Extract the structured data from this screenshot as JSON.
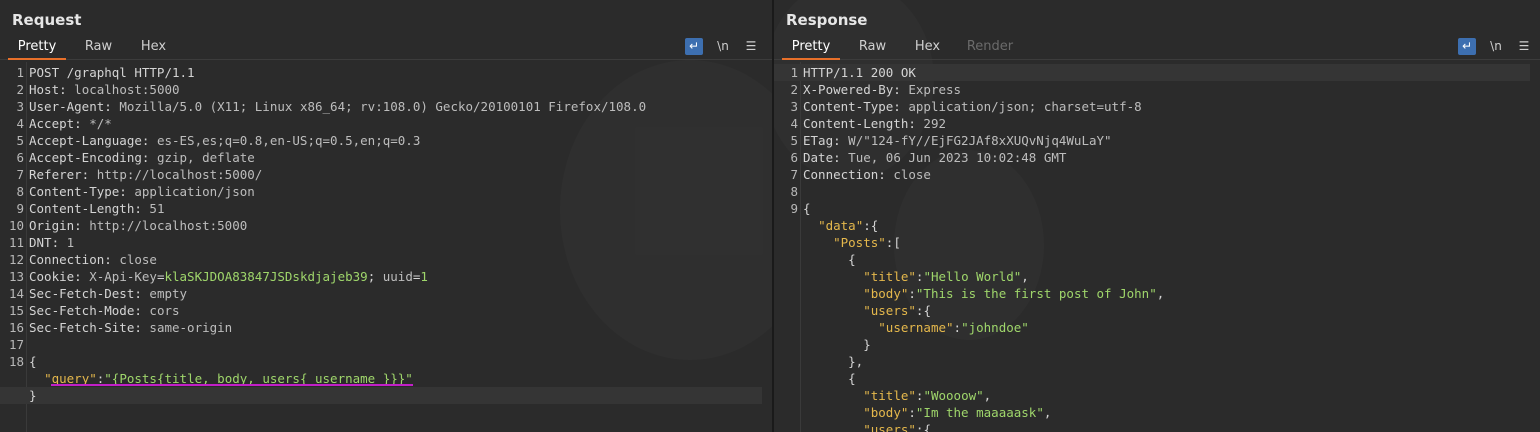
{
  "request": {
    "title": "Request",
    "tabs": [
      "Pretty",
      "Raw",
      "Hex"
    ],
    "tools": {
      "wrap_icon": "↵",
      "newline": "\\n",
      "menu": "☰"
    },
    "lines": [
      {
        "n": "1",
        "k": "POST /graphql HTTP/1.1",
        "v": ""
      },
      {
        "n": "2",
        "k": "Host:",
        "v": " localhost:5000"
      },
      {
        "n": "3",
        "k": "User-Agent:",
        "v": " Mozilla/5.0 (X11; Linux x86_64; rv:108.0) Gecko/20100101 Firefox/108.0"
      },
      {
        "n": "4",
        "k": "Accept:",
        "v": " */*"
      },
      {
        "n": "5",
        "k": "Accept-Language:",
        "v": " es-ES,es;q=0.8,en-US;q=0.5,en;q=0.3"
      },
      {
        "n": "6",
        "k": "Accept-Encoding:",
        "v": " gzip, deflate"
      },
      {
        "n": "7",
        "k": "Referer:",
        "v": " http://localhost:5000/"
      },
      {
        "n": "8",
        "k": "Content-Type:",
        "v": " application/json"
      },
      {
        "n": "9",
        "k": "Content-Length:",
        "v": " 51"
      },
      {
        "n": "10",
        "k": "Origin:",
        "v": " http://localhost:5000"
      },
      {
        "n": "11",
        "k": "DNT:",
        "v": " 1"
      },
      {
        "n": "12",
        "k": "Connection:",
        "v": " close"
      },
      {
        "n": "13",
        "cookie": true,
        "k": "Cookie:",
        "c1k": " X-Api-Key",
        "c1v": "klaSKJDOA83847JSDskdjajeb39",
        "sep": "; ",
        "c2k": "uuid",
        "c2v": "1"
      },
      {
        "n": "14",
        "k": "Sec-Fetch-Dest:",
        "v": " empty"
      },
      {
        "n": "15",
        "k": "Sec-Fetch-Mode:",
        "v": " cors"
      },
      {
        "n": "16",
        "k": "Sec-Fetch-Site:",
        "v": " same-origin"
      },
      {
        "n": "17",
        "k": "",
        "v": ""
      },
      {
        "n": "18",
        "k": "{",
        "v": ""
      },
      {
        "n": "",
        "json": true,
        "indent": "  ",
        "key": "\"query\"",
        "colon": ":",
        "val": "\"{Posts{title, body, users{ username }}}\"",
        "tail": ""
      },
      {
        "n": "",
        "k": "}",
        "v": "",
        "cursor": true
      }
    ]
  },
  "response": {
    "title": "Response",
    "tabs": [
      "Pretty",
      "Raw",
      "Hex",
      "Render"
    ],
    "tools": {
      "wrap_icon": "↵",
      "newline": "\\n",
      "menu": "☰"
    },
    "lines": [
      {
        "n": "1",
        "k": "HTTP/1.1 200 OK",
        "v": "",
        "cursor": true
      },
      {
        "n": "2",
        "k": "X-Powered-By:",
        "v": " Express"
      },
      {
        "n": "3",
        "k": "Content-Type:",
        "v": " application/json; charset=utf-8"
      },
      {
        "n": "4",
        "k": "Content-Length:",
        "v": " 292"
      },
      {
        "n": "5",
        "k": "ETag:",
        "v": " W/\"124-fY//EjFG2JAf8xXUQvNjq4WuLaY\""
      },
      {
        "n": "6",
        "k": "Date:",
        "v": " Tue, 06 Jun 2023 10:02:48 GMT"
      },
      {
        "n": "7",
        "k": "Connection:",
        "v": " close"
      },
      {
        "n": "8",
        "k": "",
        "v": ""
      },
      {
        "n": "9",
        "k": "{",
        "v": ""
      },
      {
        "n": "",
        "json": true,
        "indent": "  ",
        "key": "\"data\"",
        "colon": ":",
        "val": "",
        "tail": "{"
      },
      {
        "n": "",
        "json": true,
        "indent": "    ",
        "key": "\"Posts\"",
        "colon": ":",
        "val": "",
        "tail": "["
      },
      {
        "n": "",
        "k": "      {",
        "v": ""
      },
      {
        "n": "",
        "json": true,
        "indent": "        ",
        "key": "\"title\"",
        "colon": ":",
        "val": "\"Hello World\"",
        "tail": ","
      },
      {
        "n": "",
        "json": true,
        "indent": "        ",
        "key": "\"body\"",
        "colon": ":",
        "val": "\"This is the first post of John\"",
        "tail": ","
      },
      {
        "n": "",
        "json": true,
        "indent": "        ",
        "key": "\"users\"",
        "colon": ":",
        "val": "",
        "tail": "{"
      },
      {
        "n": "",
        "json": true,
        "indent": "          ",
        "key": "\"username\"",
        "colon": ":",
        "val": "\"johndoe\"",
        "tail": ""
      },
      {
        "n": "",
        "k": "        }",
        "v": ""
      },
      {
        "n": "",
        "k": "      },",
        "v": ""
      },
      {
        "n": "",
        "k": "      {",
        "v": ""
      },
      {
        "n": "",
        "json": true,
        "indent": "        ",
        "key": "\"title\"",
        "colon": ":",
        "val": "\"Woooow\"",
        "tail": ","
      },
      {
        "n": "",
        "json": true,
        "indent": "        ",
        "key": "\"body\"",
        "colon": ":",
        "val": "\"Im the maaaaask\"",
        "tail": ","
      },
      {
        "n": "",
        "json": true,
        "indent": "        ",
        "key": "\"users\"",
        "colon": ":",
        "val": "",
        "tail": "{"
      }
    ]
  },
  "colors": {
    "background": "#2b2b2b",
    "active_tab_underline": "#e8702a",
    "highlight_underline": "#c21fc7",
    "json_key": "#e5b84c",
    "json_string": "#9fd66b",
    "tool_active": "#3d6fb0"
  },
  "layout_buttons": [
    "split-horizontal-icon",
    "split-vertical-icon",
    "tabs-icon"
  ]
}
